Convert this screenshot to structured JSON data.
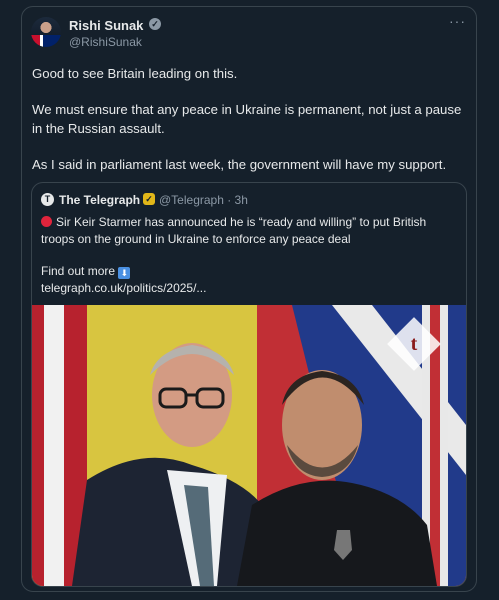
{
  "tweet": {
    "author_name": "Rishi Sunak",
    "author_handle": "@RishiSunak",
    "more_icon": "ellipsis-icon",
    "paragraphs": [
      "Good to see Britain leading on this.",
      "We must ensure that any peace in Ukraine is permanent, not just a pause in the Russian assault.",
      "As I said in parliament last week, the government will have my support."
    ]
  },
  "quote": {
    "author_name": "The Telegraph",
    "author_handle": "@Telegraph · 3h",
    "text": "Sir Keir Starmer has announced he is “ready and willing” to put British troops on the ground in Ukraine to enforce any peace deal",
    "find_out_more": "Find out more",
    "link": "telegraph.co.uk/politics/2025/...",
    "watermark": "t"
  },
  "colors": {
    "background": "#15202b",
    "border": "#38444d",
    "text": "#e7e9ea",
    "muted": "#8b98a5",
    "red_dot": "#e0243c"
  }
}
